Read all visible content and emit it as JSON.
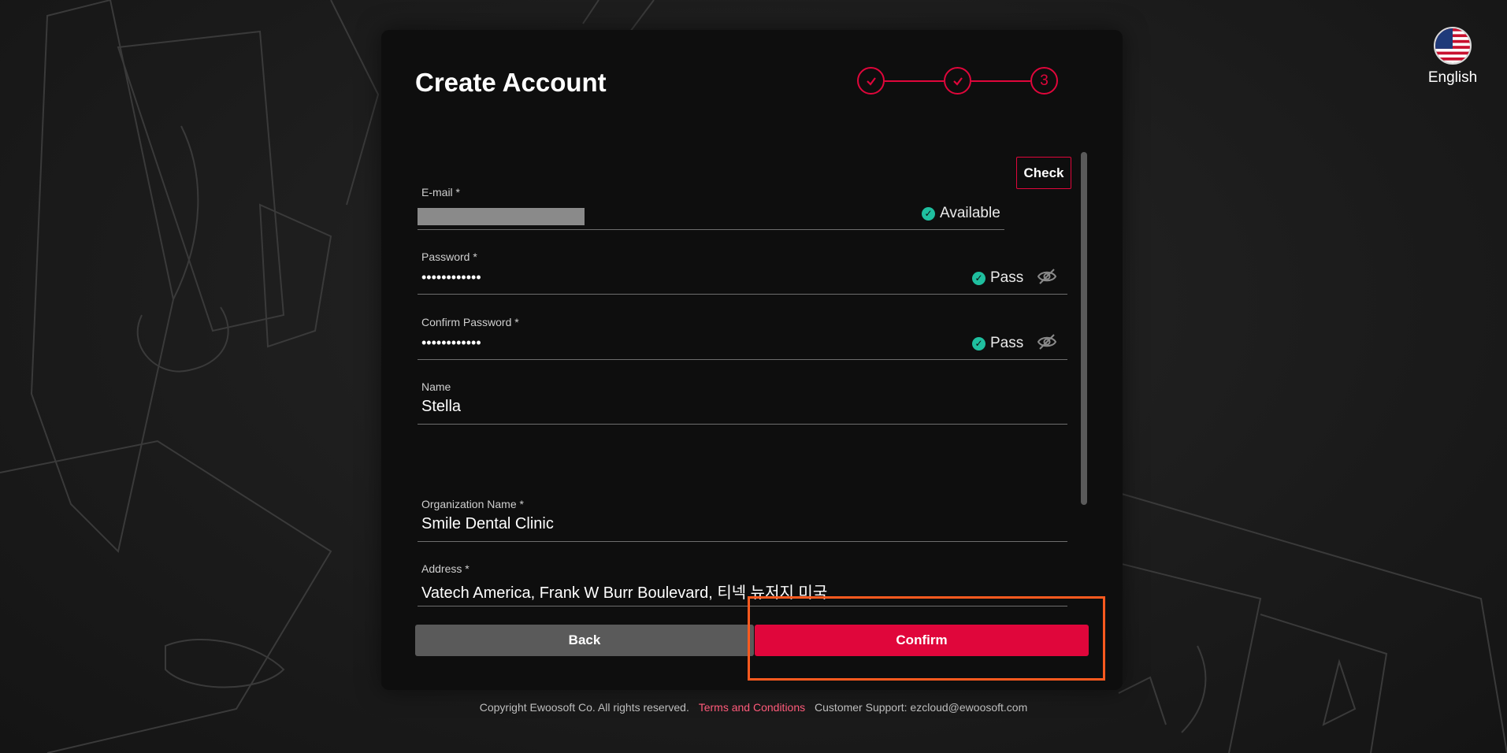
{
  "page": {
    "title": "Create Account"
  },
  "language": {
    "label": "English",
    "icon": "us-flag-icon"
  },
  "stepper": {
    "steps": [
      {
        "state": "done",
        "icon": "check-icon"
      },
      {
        "state": "done",
        "icon": "check-icon"
      },
      {
        "state": "current",
        "label": "3"
      }
    ],
    "color": "#e0063b"
  },
  "form": {
    "email": {
      "label": "E-mail *",
      "value_redacted": true,
      "status": "Available",
      "check_label": "Check"
    },
    "password": {
      "label": "Password *",
      "value": "••••••••••••",
      "status": "Pass"
    },
    "confirm_password": {
      "label": "Confirm Password *",
      "value": "••••••••••••",
      "status": "Pass"
    },
    "name": {
      "label": "Name",
      "value": "Stella"
    },
    "organization": {
      "label": "Organization Name *",
      "value": "Smile Dental Clinic"
    },
    "address": {
      "label": "Address *",
      "value": "Vatech America, Frank W Burr Boulevard, 티넥 뉴저지 미국"
    }
  },
  "buttons": {
    "back": "Back",
    "confirm": "Confirm"
  },
  "footer": {
    "copyright": "Copyright Ewoosoft Co. All rights reserved.",
    "terms": "Terms and Conditions",
    "support": "Customer Support: ezcloud@ewoosoft.com"
  },
  "colors": {
    "accent": "#e0063b",
    "success": "#1fbf9f",
    "highlight": "#ff5a1f"
  }
}
